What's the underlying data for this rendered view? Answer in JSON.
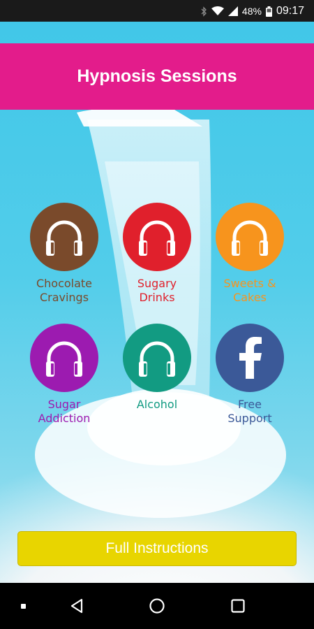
{
  "status_bar": {
    "battery": "48%",
    "time": "09:17",
    "icons": [
      "bluetooth-icon",
      "wifi-icon",
      "signal-icon",
      "battery-icon"
    ]
  },
  "header": {
    "title": "Hypnosis Sessions"
  },
  "sessions": [
    {
      "line1": "Chocolate",
      "line2": "Cravings",
      "color": "#7a4a2b",
      "label_color": "#7a4a2b",
      "icon": "headphones-icon"
    },
    {
      "line1": "Sugary",
      "line2": "Drinks",
      "color": "#e0202c",
      "label_color": "#e0202c",
      "icon": "headphones-icon"
    },
    {
      "line1": "Sweets &",
      "line2": "Cakes",
      "color": "#f7941d",
      "label_color": "#f7941d",
      "icon": "headphones-icon"
    },
    {
      "line1": "Sugar",
      "line2": "Addiction",
      "color": "#9c1bb0",
      "label_color": "#9c1bb0",
      "icon": "headphones-icon"
    },
    {
      "line1": "Alcohol",
      "line2": "",
      "color": "#129b82",
      "label_color": "#129b82",
      "icon": "headphones-icon"
    },
    {
      "line1": "Free",
      "line2": "Support",
      "color": "#3b5998",
      "label_color": "#3b5998",
      "icon": "facebook-icon"
    }
  ],
  "instructions_button": {
    "label": "Full Instructions"
  },
  "nav": {
    "icons": [
      "recent-dot-icon",
      "back-icon",
      "home-icon",
      "overview-icon"
    ]
  }
}
